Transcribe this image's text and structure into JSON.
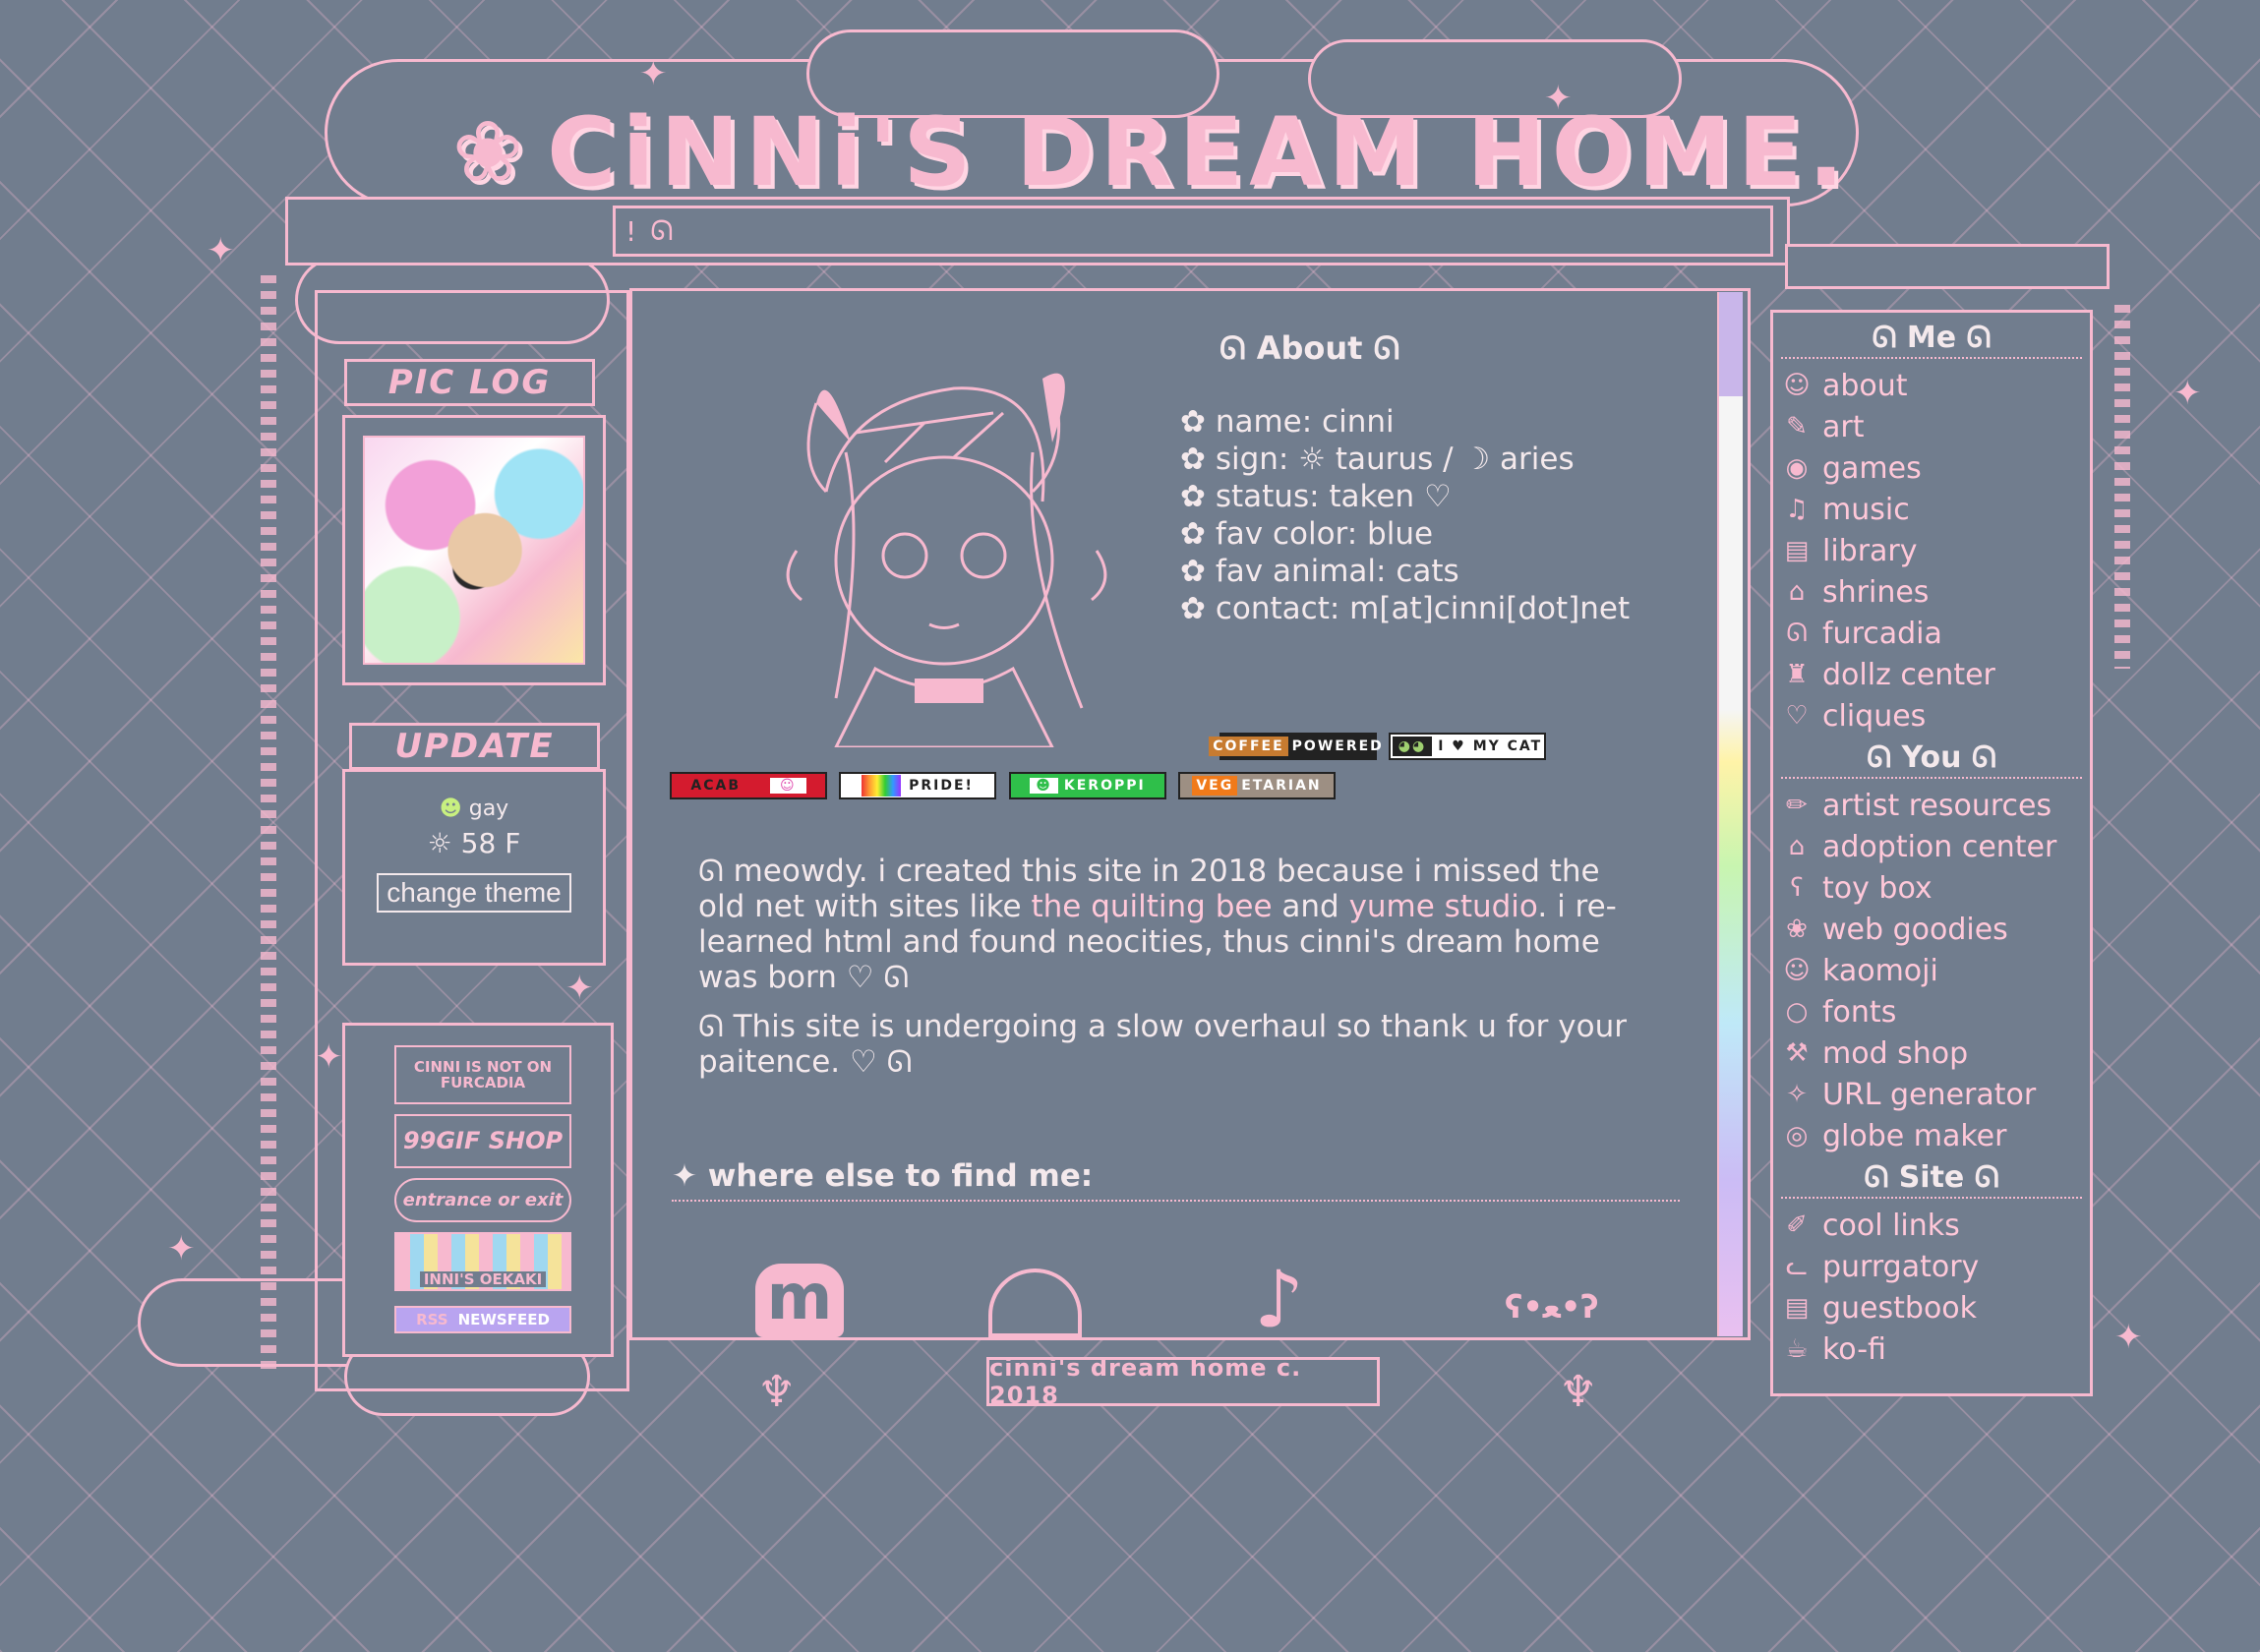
{
  "header": {
    "title": "CiNNi'S DREAM HOME.",
    "marquee_text": "!"
  },
  "left": {
    "pic_log_label": "PIC LOG",
    "update_label": "UPDATE",
    "mood": "gay",
    "weather": "☼ 58  F",
    "change_theme_label": "change theme",
    "badges": [
      "CINNI IS NOT ON FURCADIA",
      "99GIF SHOP",
      "entrance or exit",
      "INNI'S OEKAKI",
      "RSS",
      "NEWSFEED"
    ]
  },
  "about": {
    "title": "About",
    "items": [
      "name: cinni",
      "sign: ☼ taurus / ☽ aries",
      "status: taken ♡",
      "fav color: blue",
      "fav animal: cats",
      "contact: m[at]cinni[dot]net"
    ]
  },
  "badges88": {
    "coffee": "COFFEE",
    "powered": "POWERED",
    "cat_heart": "I ♥ MY CAT",
    "acab": "ACAB",
    "pride": "PRIDE!",
    "keroppi": "KEROPPI",
    "veg": "VEG",
    "etarian": "ETARIAN"
  },
  "intro": {
    "p1_a": "meowdy. i created this site in 2018 because i missed the old net with sites like ",
    "link1": "the quilting bee",
    "p1_b": " and ",
    "link2": "yume studio",
    "p1_c": ". i re-learned html and found neocities, thus cinni's dream home was born ♡",
    "p2": "This site is undergoing a slow overhaul so thank u for your paitence. ♡"
  },
  "find": {
    "heading": "✦ where else to find me:",
    "socials": [
      "m",
      "ʕ•ﻌ•ʔ"
    ]
  },
  "footer": {
    "text": "cinni's dream home c. 2018"
  },
  "nav": {
    "me_head": "Me",
    "me_items": [
      "about",
      "art",
      "games",
      "music",
      "library",
      "shrines",
      "furcadia",
      "dollz center",
      "cliques"
    ],
    "you_head": "You",
    "you_items": [
      "artist resources",
      "adoption center",
      "toy box",
      "web goodies",
      "kaomoji",
      "fonts",
      "mod shop",
      "URL generator",
      "globe maker"
    ],
    "site_head": "Site",
    "site_items": [
      "cool links",
      "purrgatory",
      "guestbook",
      "ko-fi"
    ]
  }
}
